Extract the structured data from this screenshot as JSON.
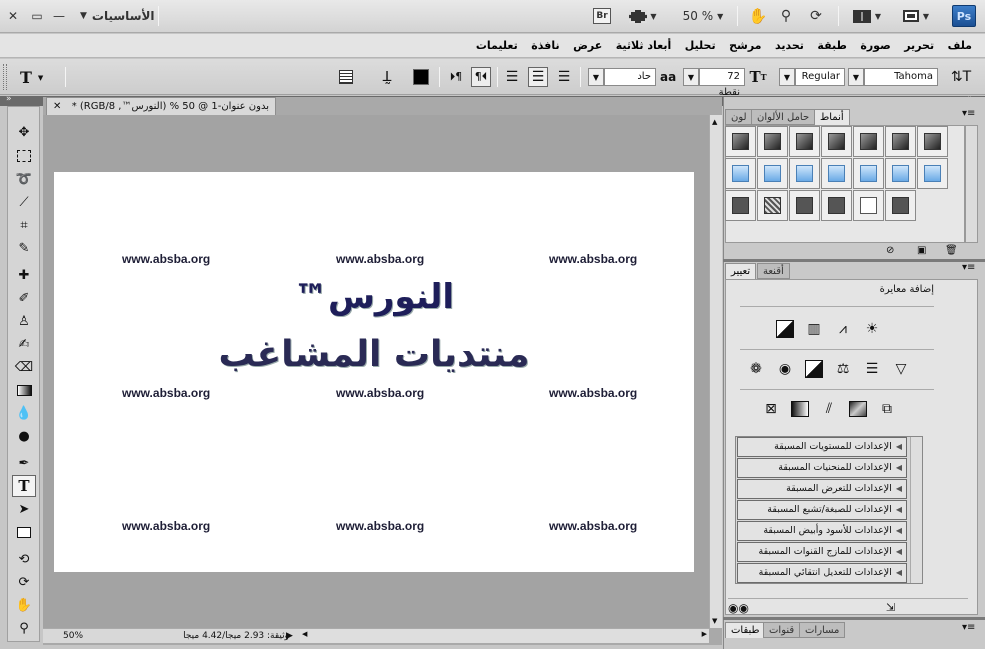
{
  "titlebar": {
    "workspace": "الأساسيات",
    "bridge": "Br",
    "zoom": "50 %",
    "app_logo": "Ps",
    "icons": [
      "hand-icon",
      "zoom-icon",
      "rotate-view-icon",
      "arrange-documents-icon",
      "screen-mode-icon",
      "minimize-icon",
      "restore-icon",
      "close-icon"
    ]
  },
  "menu": [
    "ملف",
    "تحرير",
    "صورة",
    "طبقة",
    "تحديد",
    "مرشح",
    "تحليل",
    "أبعاد ثلاثية",
    "عرض",
    "نافذة",
    "تعليمات"
  ],
  "options": {
    "tool": "T",
    "font_family": "Tahoma",
    "font_style": "Regular",
    "font_size": "72 نقطة",
    "aa_label": "aa",
    "antialias": "حاد",
    "text_color": "#000000"
  },
  "document": {
    "tab_title": "بدون عنوان-1 @ 50 % (النورس™, RGB/8) *",
    "watermark": "www.absba.org",
    "headline1": "™النورس",
    "headline2": "منتديات المشاغب",
    "zoom_status": "50%",
    "doc_info": "وثيقة: 2.93 ميجا/4.42 ميجا"
  },
  "panels": {
    "top_tabs": [
      "أنماط",
      "حامل الألوان",
      "لون"
    ],
    "adjust_tabs": [
      "تعيير",
      "أقنعة"
    ],
    "add_adjustment": "إضافة معايرة",
    "presets": [
      "الإعدادات للمستويات المسبقة",
      "الإعدادات للمنحنيات المسبقة",
      "الإعدادات للتعرض المسبقة",
      "الإعدادات للصبغة/تشبع المسبقة",
      "الإعدادات للأسود وأبيض المسبقة",
      "الإعدادات للمازج القنوات المسبقة",
      "الإعدادات للتعديل انتقائي المسبقة"
    ],
    "bottom_tabs": [
      "طبقات",
      "قنوات",
      "مسارات"
    ]
  },
  "colors": {
    "accent_blue": "#1b4f93",
    "headline": "#1e1e5a"
  }
}
